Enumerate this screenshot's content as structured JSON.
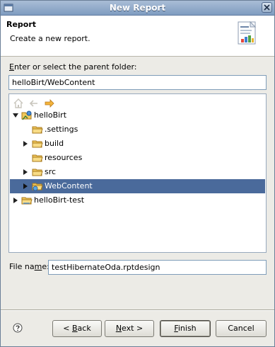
{
  "window": {
    "title": "New Report"
  },
  "banner": {
    "title": "Report",
    "message": "Create a new report."
  },
  "parent_folder": {
    "label_mnemonic": "E",
    "label_rest": "nter or select the parent folder:",
    "value": "helloBirt/WebContent"
  },
  "tree": {
    "items": [
      {
        "label": "helloBirt",
        "expanded": true,
        "icon": "project-icon"
      },
      {
        "label": ".settings",
        "icon": "folder-icon"
      },
      {
        "label": "build",
        "icon": "folder-icon",
        "expandable": true
      },
      {
        "label": "resources",
        "icon": "folder-icon"
      },
      {
        "label": "src",
        "icon": "folder-icon",
        "expandable": true
      },
      {
        "label": "WebContent",
        "icon": "web-folder-icon",
        "expandable": true,
        "selected": true
      },
      {
        "label": "helloBirt-test",
        "icon": "project-icon",
        "expandable": true
      }
    ]
  },
  "file_name": {
    "label_pre": "File na",
    "label_mnemonic": "m",
    "label_post": "e:",
    "value": "testHibernateOda.rptdesign"
  },
  "buttons": {
    "back_pre": "< ",
    "back_mnemonic": "B",
    "back_post": "ack",
    "next_mnemonic": "N",
    "next_post": "ext >",
    "finish_mnemonic": "F",
    "finish_post": "inish",
    "cancel": "Cancel"
  },
  "colors": {
    "selection": "#4a6a9b",
    "titlebar": "#8fa9c9"
  }
}
